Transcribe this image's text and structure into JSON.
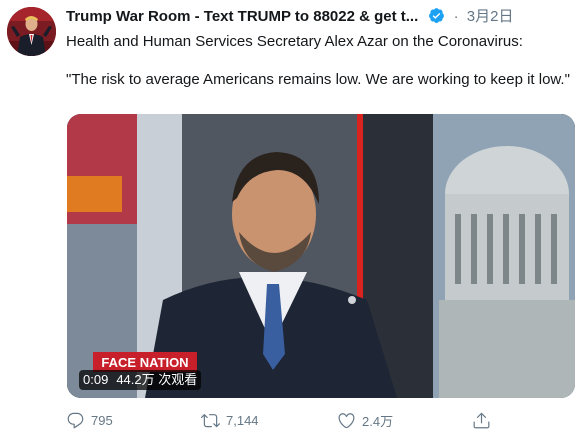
{
  "tweet": {
    "display_name": "Trump War Room - Text TRUMP to 88022 & get t...",
    "verified_icon": "verified-badge-icon",
    "separator": "·",
    "date": "3月2日",
    "paragraph1": "Health and Human Services Secretary Alex Azar on the Coronavirus:",
    "paragraph2": "\"The risk to average Americans remains low. We are working to keep it low.\""
  },
  "video": {
    "duration": "0:09",
    "views": "44.2万 次观看",
    "lower_third": "FACE NATION"
  },
  "actions": {
    "reply_count": "795",
    "retweet_count": "7,144",
    "like_count": "2.4万",
    "share_icon": "share-icon"
  },
  "colors": {
    "accent": "#1da1f2",
    "muted": "#657786",
    "text": "#14171a"
  }
}
